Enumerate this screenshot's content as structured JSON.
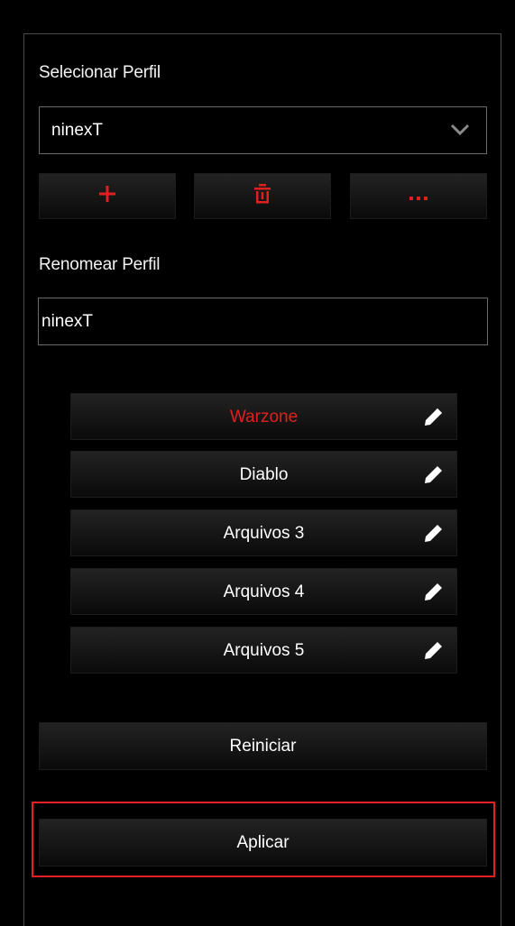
{
  "profile_select": {
    "label": "Selecionar Perfil",
    "value": "ninexT"
  },
  "toolbar": {
    "add_icon": "plus-icon",
    "delete_icon": "trash-icon",
    "more_icon": "ellipsis-icon",
    "icon_color": "#e0201f"
  },
  "rename": {
    "label": "Renomear Perfil",
    "value": "ninexT"
  },
  "files": [
    {
      "label": "Warzone",
      "active": true
    },
    {
      "label": "Diablo",
      "active": false
    },
    {
      "label": "Arquivos 3",
      "active": false
    },
    {
      "label": "Arquivos 4",
      "active": false
    },
    {
      "label": "Arquivos 5",
      "active": false
    }
  ],
  "actions": {
    "reset_label": "Reiniciar",
    "apply_label": "Aplicar"
  },
  "colors": {
    "accent": "#e0201f",
    "highlight_border": "#e81f25"
  }
}
